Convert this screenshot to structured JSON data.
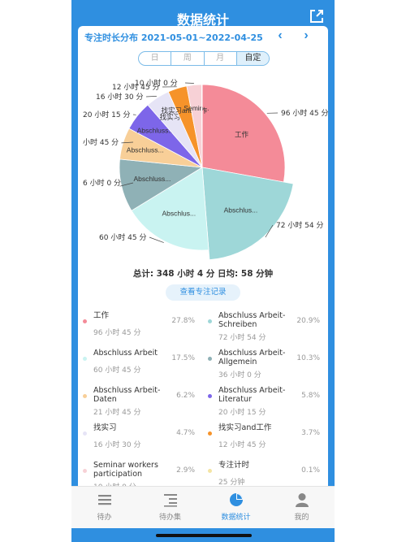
{
  "header": {
    "title": "数据统计",
    "share_icon": "share-icon"
  },
  "range": {
    "label": "专注时长分布 2021-05-01~2022-04-25"
  },
  "segments": [
    {
      "label": "日",
      "active": false
    },
    {
      "label": "周",
      "active": false
    },
    {
      "label": "月",
      "active": false
    },
    {
      "label": "自定",
      "active": true
    }
  ],
  "summary": "总计: 348 小时 4 分  日均: 58 分钟",
  "view_records": "查看专注记录",
  "chart_data": {
    "type": "pie",
    "slices": [
      {
        "name": "工作",
        "pct": 27.8,
        "duration": "96 小时 45 分",
        "color": "#f48b98",
        "inner_label": "工作",
        "outer_label": "96 小时 45 分"
      },
      {
        "name": "Abschluss Arbeit-Schreiben",
        "pct": 20.9,
        "duration": "72 小时 54 分",
        "color": "#9ed7d8",
        "inner_label": "Abschlus...",
        "outer_label": "72 小时 54 分"
      },
      {
        "name": "Abschluss Arbeit",
        "pct": 17.5,
        "duration": "60 小时 45 分",
        "color": "#c9f3f1",
        "inner_label": "Abschlus...",
        "outer_label": "60 小时 45 分"
      },
      {
        "name": "Abschluss Arbeit-Allgemein",
        "pct": 10.3,
        "duration": "36 小时 0 分",
        "color": "#8fb1b6",
        "inner_label": "Abschluss...",
        "outer_label": "6 小时 0 分"
      },
      {
        "name": "Abschluss Arbeit-Daten",
        "pct": 6.2,
        "duration": "21 小时 45 分",
        "color": "#f8cf98",
        "inner_label": "Abschluss...",
        "outer_label": "小时 45 分"
      },
      {
        "name": "Abschluss Arbeit-Literatur",
        "pct": 5.8,
        "duration": "20 小时 15 分",
        "color": "#7d66e9",
        "inner_label": "Abschluss...",
        "outer_label": "20 小时 15 分"
      },
      {
        "name": "找实习",
        "pct": 4.7,
        "duration": "16 小时 30 分",
        "color": "#e6e4f6",
        "inner_label": "找实习",
        "outer_label": "16 小时 30 分"
      },
      {
        "name": "找实习and工作",
        "pct": 3.7,
        "duration": "12 小时 45 分",
        "color": "#f6932a",
        "inner_label": "找实习and工作",
        "outer_label": "12 小时 45 分"
      },
      {
        "name": "Seminar workers participation",
        "pct": 2.9,
        "duration": "10 小时 0 分",
        "color": "#f7d1d6",
        "inner_label": "Semin...",
        "outer_label": "10 小时 0 分"
      },
      {
        "name": "专注计时",
        "pct": 0.1,
        "duration": "25 分钟",
        "color": "#f4e4a4",
        "inner_label": "",
        "outer_label": ""
      }
    ]
  },
  "legend": [
    {
      "name": "工作",
      "duration": "96 小时 45 分",
      "pct": "27.8%",
      "color": "#f48b98"
    },
    {
      "name": "Abschluss Arbeit-Schreiben",
      "duration": "72 小时 54 分",
      "pct": "20.9%",
      "color": "#9ed7d8"
    },
    {
      "name": "Abschluss Arbeit",
      "duration": "60 小时 45 分",
      "pct": "17.5%",
      "color": "#c9f3f1"
    },
    {
      "name": "Abschluss Arbeit-Allgemein",
      "duration": "36 小时 0 分",
      "pct": "10.3%",
      "color": "#8fb1b6"
    },
    {
      "name": "Abschluss Arbeit-Daten",
      "duration": "21 小时 45 分",
      "pct": "6.2%",
      "color": "#f8cf98"
    },
    {
      "name": "Abschluss Arbeit-Literatur",
      "duration": "20 小时 15 分",
      "pct": "5.8%",
      "color": "#7d66e9"
    },
    {
      "name": "找实习",
      "duration": "16 小时 30 分",
      "pct": "4.7%",
      "color": "#e6e4f6"
    },
    {
      "name": "找实习and工作",
      "duration": "12 小时 45 分",
      "pct": "3.7%",
      "color": "#f6932a"
    },
    {
      "name": "Seminar workers participation",
      "duration": "10 小时 0 分",
      "pct": "2.9%",
      "color": "#f7d1d6"
    },
    {
      "name": "专注计时",
      "duration": "25 分钟",
      "pct": "0.1%",
      "color": "#f4e4a4"
    }
  ],
  "tabs": [
    {
      "label": "待办",
      "icon": "list-icon",
      "active": false
    },
    {
      "label": "待办集",
      "icon": "checklist-icon",
      "active": false
    },
    {
      "label": "数据统计",
      "icon": "pie-chart-icon",
      "active": true
    },
    {
      "label": "我的",
      "icon": "person-icon",
      "active": false
    }
  ],
  "colors": {
    "primary": "#2f8fe0"
  }
}
